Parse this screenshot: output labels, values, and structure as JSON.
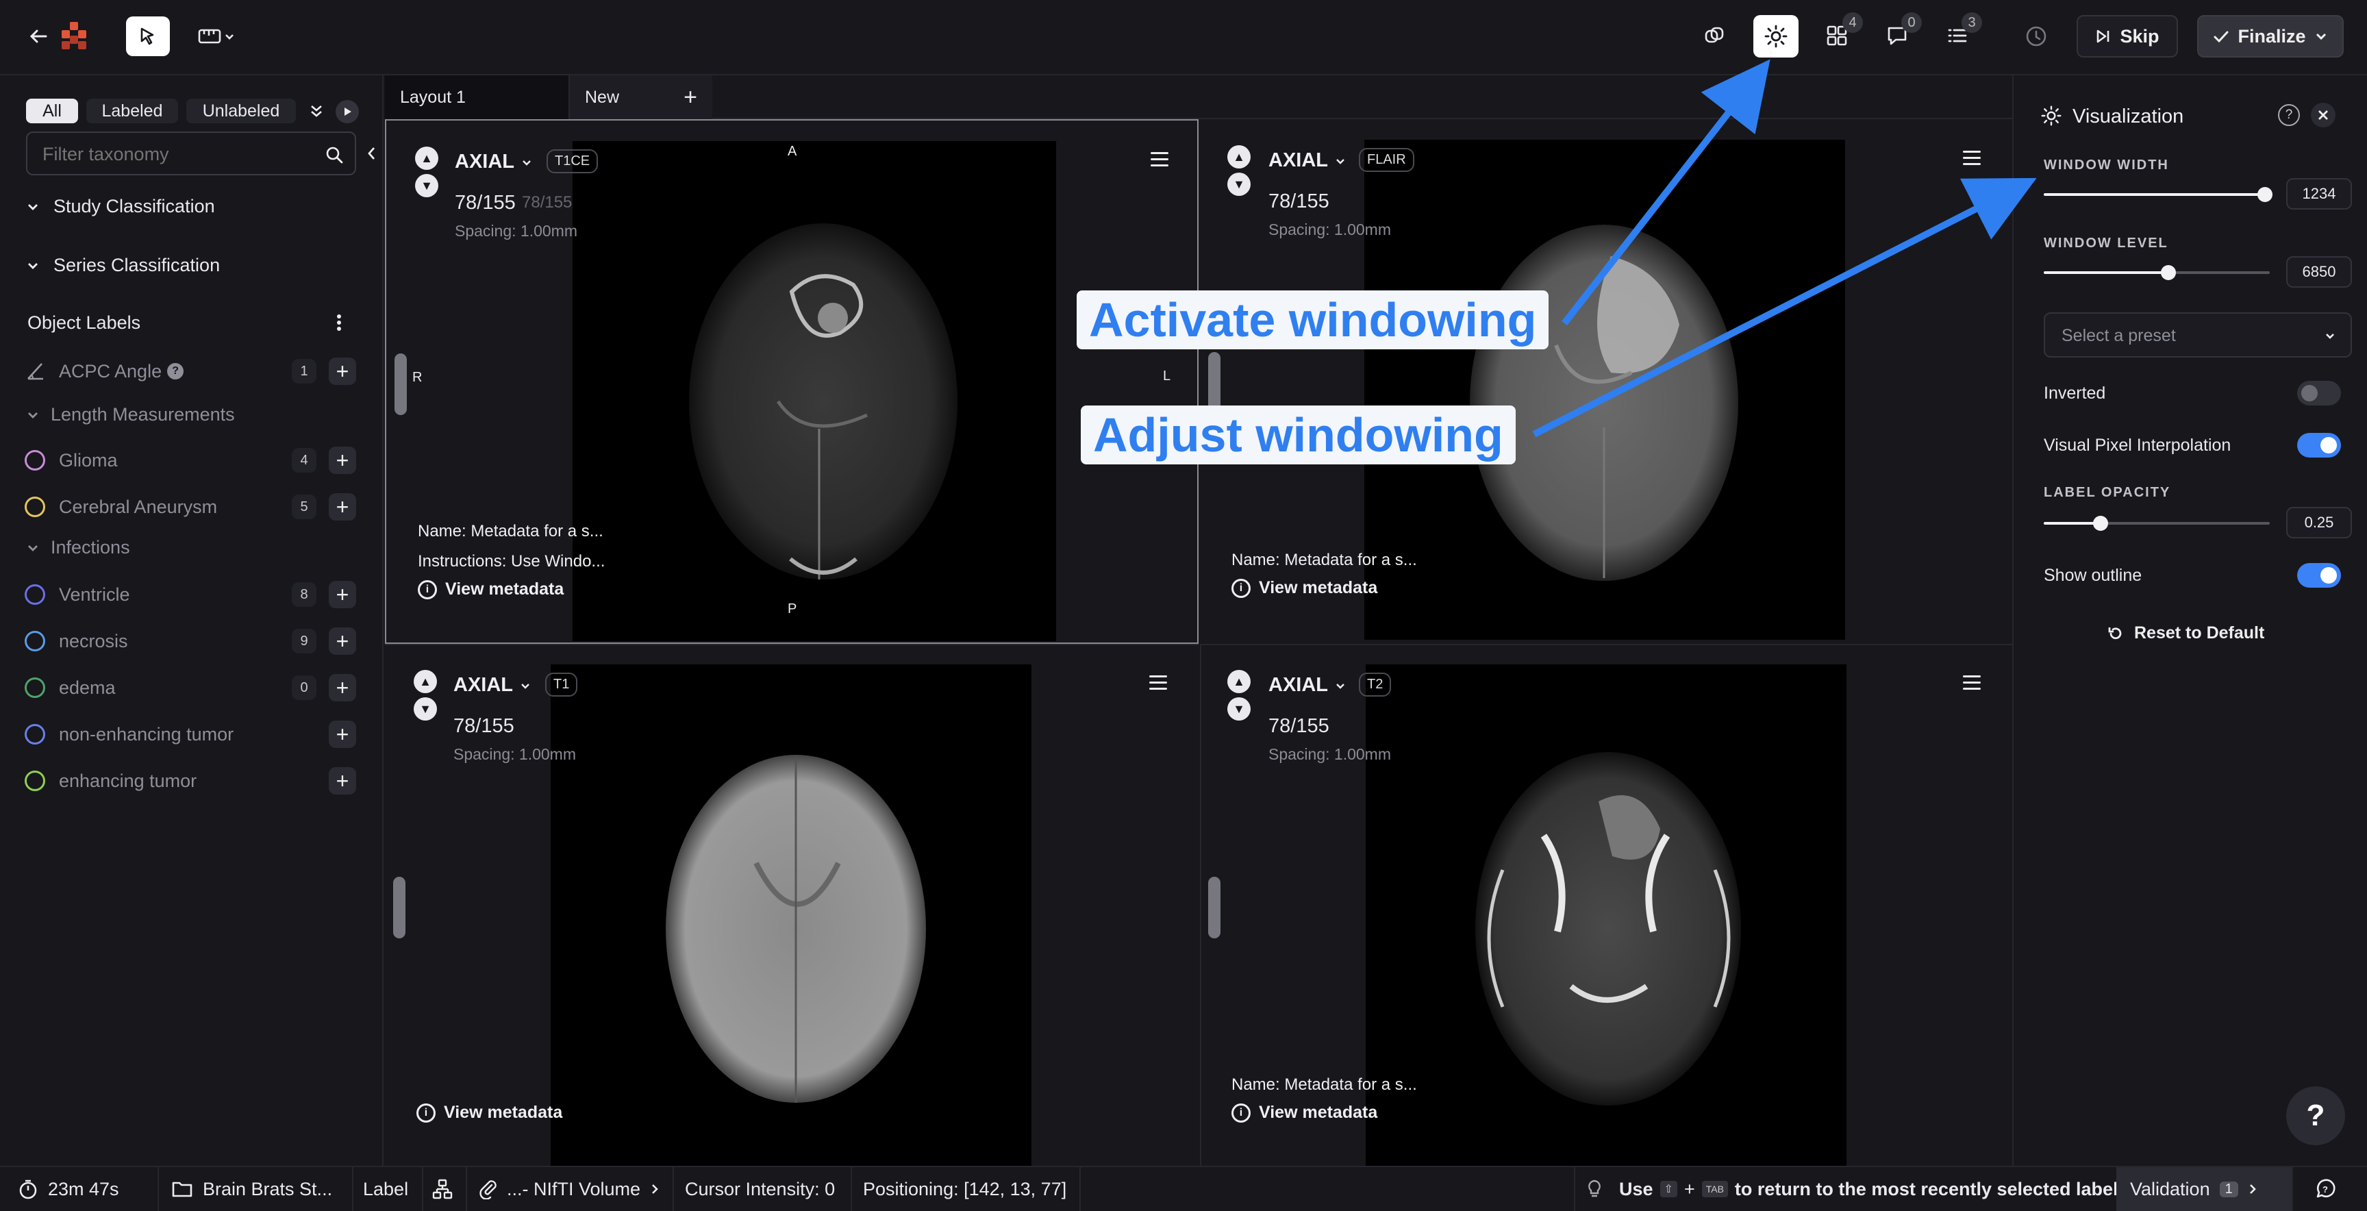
{
  "topbar": {
    "badges": {
      "layouts": "4",
      "comments": "0",
      "tasks": "3"
    },
    "skip_label": "Skip",
    "finalize_label": "Finalize"
  },
  "sidebar": {
    "filters": [
      "All",
      "Labeled",
      "Unlabeled"
    ],
    "search_placeholder": "Filter taxonomy",
    "study_classification": "Study Classification",
    "series_classification": "Series Classification",
    "object_labels_title": "Object Labels",
    "labels": [
      {
        "name": "ACPC Angle",
        "count": "1",
        "color": "#9a9aa3"
      },
      {
        "name": "Glioma",
        "count": "4",
        "color": "#c98bd8"
      },
      {
        "name": "Cerebral Aneurysm",
        "count": "5",
        "color": "#e6c45a"
      },
      {
        "name": "Ventricle",
        "count": "8",
        "color": "#6b6fe6"
      },
      {
        "name": "necrosis",
        "count": "9",
        "color": "#5a9be6"
      },
      {
        "name": "edema",
        "count": "0",
        "color": "#4fa36a"
      },
      {
        "name": "non-enhancing tumor",
        "count": "",
        "color": "#6b7fe6"
      },
      {
        "name": "enhancing tumor",
        "count": "",
        "color": "#8fcf4f"
      }
    ],
    "groups": [
      "Length Measurements",
      "Infections"
    ]
  },
  "tabs": {
    "layout1": "Layout 1",
    "new": "New"
  },
  "viewports": [
    {
      "orientation": "AXIAL",
      "sequence": "T1CE",
      "slice": "78/155",
      "slice_ghost": "78/155",
      "spacing": "Spacing: 1.00mm",
      "name": "Name: Metadata for a s...",
      "instructions": "Instructions: Use Windo...",
      "view_meta": "View metadata",
      "orient_top": "A",
      "orient_bottom": "P",
      "orient_left": "R",
      "orient_right": "L"
    },
    {
      "orientation": "AXIAL",
      "sequence": "FLAIR",
      "slice": "78/155",
      "spacing": "Spacing: 1.00mm",
      "name": "Name: Metadata for a s...",
      "view_meta": "View metadata"
    },
    {
      "orientation": "AXIAL",
      "sequence": "T1",
      "slice": "78/155",
      "spacing": "Spacing: 1.00mm",
      "view_meta": "View metadata"
    },
    {
      "orientation": "AXIAL",
      "sequence": "T2",
      "slice": "78/155",
      "spacing": "Spacing: 1.00mm",
      "name": "Name: Metadata for a s...",
      "view_meta": "View metadata"
    }
  ],
  "visualization": {
    "title": "Visualization",
    "window_width_label": "WINDOW WIDTH",
    "window_width_value": "1234",
    "window_width_level": 0.98,
    "window_level_label": "WINDOW LEVEL",
    "window_level_value": "6850",
    "window_level_level": 0.55,
    "preset_placeholder": "Select a preset",
    "inverted_label": "Inverted",
    "inverted_on": false,
    "interpolation_label": "Visual Pixel Interpolation",
    "interpolation_on": true,
    "label_opacity_label": "LABEL OPACITY",
    "label_opacity_value": "0.25",
    "label_opacity_level": 0.25,
    "show_outline_label": "Show outline",
    "show_outline_on": true,
    "reset_label": "Reset to Default"
  },
  "annotations": {
    "activate": "Activate windowing",
    "adjust": "Adjust windowing"
  },
  "bottombar": {
    "timer": "23m 47s",
    "dataset": "Brain Brats St...",
    "label": "Label",
    "volume": "...- NIfTI Volume",
    "cursor_intensity": "Cursor Intensity: 0",
    "positioning": "Positioning: [142, 13, 77]",
    "hint_use": "Use",
    "hint_plus": "+",
    "hint_shift_key": "⇧",
    "hint_tab_key": "TAB",
    "hint_rest": "to return to the most recently selected label",
    "validation": "Validation",
    "validation_count": "1"
  },
  "colors": {
    "accent": "#2f7ff0",
    "toggle_on": "#3b82f6",
    "bg": "#17171c"
  }
}
